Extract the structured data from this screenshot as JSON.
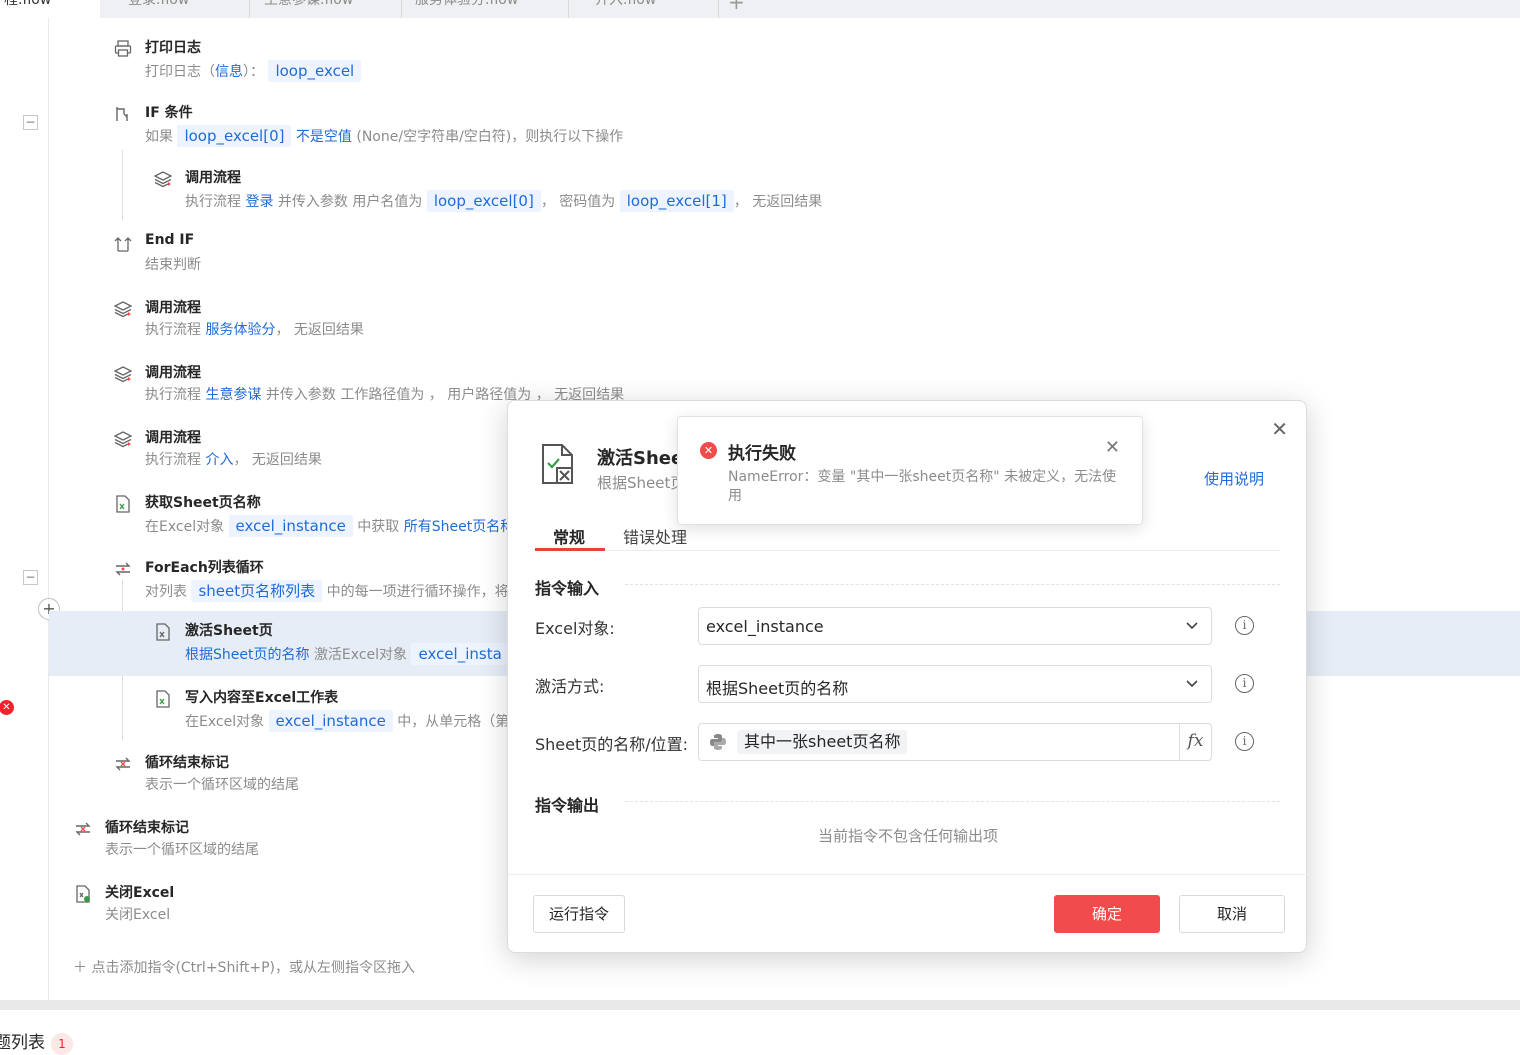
{
  "tabs": [
    {
      "label": "程.flow",
      "active": true
    },
    {
      "label": "登录.flow"
    },
    {
      "label": "生意参谋.flow"
    },
    {
      "label": "服务体验分.flow"
    },
    {
      "label": "介入.flow"
    }
  ],
  "tab_add": "+",
  "steps": {
    "s1": {
      "title": "打印日志",
      "d1": "打印日志（",
      "d2": "信息",
      "d3": "）：",
      "chip1": "loop_excel"
    },
    "s2": {
      "title": "IF 条件",
      "d1": "如果",
      "chip1": "loop_excel[0]",
      "d2": "不是空值",
      "d3": "(None/空字符串/空白符)，则执行以下操作"
    },
    "s3": {
      "title": "调用流程",
      "d1": "执行流程",
      "d2": "登录",
      "d3": "并传入参数 用户名值为",
      "chip1": "loop_excel[0]",
      "d4": "，  密码值为",
      "chip2": "loop_excel[1]",
      "d5": "，  无返回结果"
    },
    "s4": {
      "title": "End IF",
      "d1": "结束判断"
    },
    "s5": {
      "title": "调用流程",
      "d1": "执行流程",
      "d2": "服务体验分",
      "d3": "，  无返回结果"
    },
    "s6": {
      "title": "调用流程",
      "d1": "执行流程",
      "d2": "生意参谋",
      "d3": "并传入参数 工作路径值为  ，  用户路径值为  ，  无返回结果"
    },
    "s7": {
      "title": "调用流程",
      "d1": "执行流程",
      "d2": "介入",
      "d3": "，  无返回结果"
    },
    "s8": {
      "title": "获取Sheet页名称",
      "d1": "在Excel对象",
      "chip1": "excel_instance",
      "d2": "中获取",
      "d3": "所有Sheet页名称"
    },
    "s9": {
      "title": "ForEach列表循环",
      "d1": "对列表",
      "chip1": "sheet页名称列表",
      "d2": "中的每一项进行循环操作，将"
    },
    "s10": {
      "title": "激活Sheet页",
      "d1": "根据Sheet页的名称",
      "d2": "激活Excel对象",
      "chip1": "excel_insta"
    },
    "s11": {
      "title": "写入内容至Excel工作表",
      "d1": "在Excel对象",
      "chip1": "excel_instance",
      "d2": "中，从单元格（第"
    },
    "s12": {
      "title": "循环结束标记",
      "d1": "表示一个循环区域的结尾"
    },
    "s13": {
      "title": "循环结束标记",
      "d1": "表示一个循环区域的结尾"
    },
    "s14": {
      "title": "关闭Excel",
      "d1": "关闭Excel"
    }
  },
  "bottom_hint": "＋  点击添加指令(Ctrl+Shift+P)，或从左侧指令区拖入",
  "issues": {
    "label": "题列表",
    "count": "1"
  },
  "dialog": {
    "title": "激活Sheet页",
    "subtitle": "根据Sheet页",
    "help": "使用说明",
    "tabs": [
      "常规",
      "错误处理"
    ],
    "section_input": "指令输入",
    "section_output": "指令输出",
    "fields": {
      "excel_label": "Excel对象:",
      "excel_value": "excel_instance",
      "mode_label": "激活方式:",
      "mode_value": "根据Sheet页的名称",
      "sheet_label": "Sheet页的名称/位置:",
      "sheet_value": "其中一张sheet页名称",
      "fx": "fx"
    },
    "no_output": "当前指令不包含任何输出项",
    "run_button": "运行指令",
    "ok_button": "确定",
    "cancel_button": "取消"
  },
  "toast": {
    "title": "执行失败",
    "message": "NameError：变量 \"其中一张sheet页名称\" 未被定义，无法使用"
  },
  "colors": {
    "accent_red": "#f24b4b",
    "link_blue": "#1f6bd8",
    "selected_row": "#e7edf7"
  }
}
